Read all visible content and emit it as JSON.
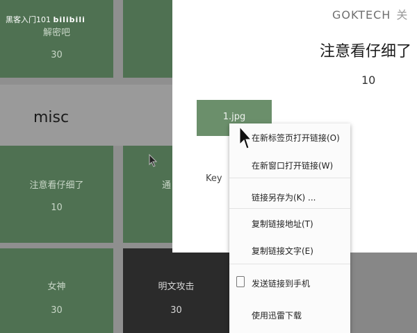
{
  "watermark": {
    "channel": "黑客入门101",
    "logo": "bilibili"
  },
  "board": {
    "top_tiles": [
      {
        "name": "解密吧",
        "points": "30"
      },
      {
        "name": "",
        "points": ""
      }
    ],
    "category": "misc",
    "middle_tiles": [
      {
        "name": "注意看仔细了",
        "points": "10"
      },
      {
        "name": "通",
        "points": ""
      }
    ],
    "bottom_tiles": [
      {
        "name": "女神",
        "points": "30"
      },
      {
        "name": "明文攻击",
        "points": "30"
      }
    ]
  },
  "modal": {
    "brand": "GOKTECH",
    "close": "关",
    "title": "注意看仔细了",
    "points": "10",
    "file_button": "1.jpg",
    "key_label": "Key"
  },
  "context_menu": {
    "items": [
      "在新标签页打开链接(O)",
      "在新窗口打开链接(W)",
      "链接另存为(K) ...",
      "复制链接地址(T)",
      "复制链接文字(E)",
      "发送链接到手机",
      "使用迅雷下载"
    ]
  },
  "colors": {
    "tile_green": "#4f7152",
    "tile_dark": "#2b2b2b",
    "button_green": "#6b8f6b"
  }
}
